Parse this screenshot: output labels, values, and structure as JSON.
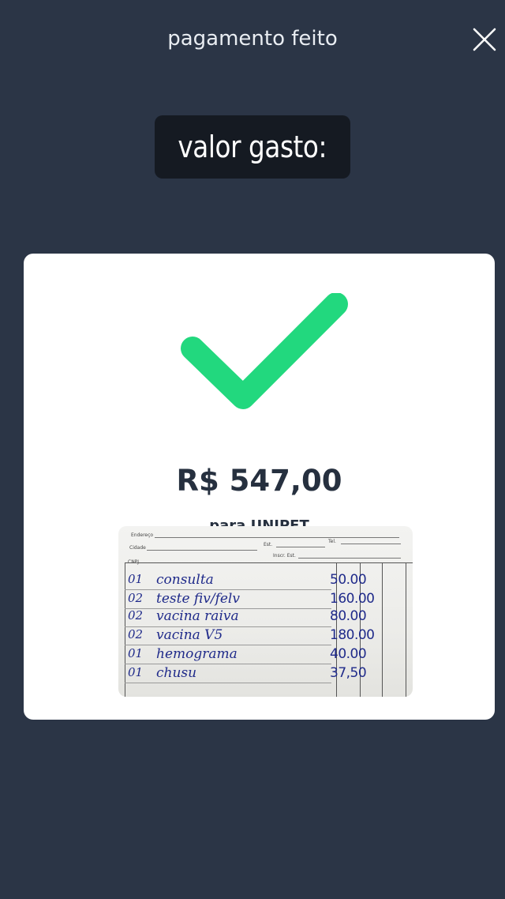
{
  "header": {
    "title": "pagamento feito",
    "close_icon": "close-icon"
  },
  "caption": {
    "text": "valor gasto:"
  },
  "card": {
    "status_icon": "checkmark-icon",
    "check_color": "#22d87e",
    "amount": "R$ 547,00",
    "recipient_partial": "para UNIPET"
  },
  "receipt_photo": {
    "form_labels": {
      "endereco": "Endereço",
      "cidade": "Cidade",
      "est": "Est.",
      "tel": "Tel.",
      "cnpj": "CNPJ",
      "inscr": "Inscr. Est."
    },
    "items": [
      {
        "qty": "01",
        "description": "consulta",
        "value": "50.00"
      },
      {
        "qty": "02",
        "description": "teste fiv/felv",
        "value": "160.00"
      },
      {
        "qty": "02",
        "description": "vacina raiva",
        "value": "80.00"
      },
      {
        "qty": "02",
        "description": "vacina V5",
        "value": "180.00"
      },
      {
        "qty": "01",
        "description": "hemograma",
        "value": "40.00"
      },
      {
        "qty": "01",
        "description": "chusu",
        "value": "37,50"
      }
    ]
  },
  "colors": {
    "background": "#2b3546",
    "caption_bg": "#151a22",
    "card_bg": "#ffffff",
    "amount_text": "#26303f",
    "ink": "#1f2a8a"
  }
}
